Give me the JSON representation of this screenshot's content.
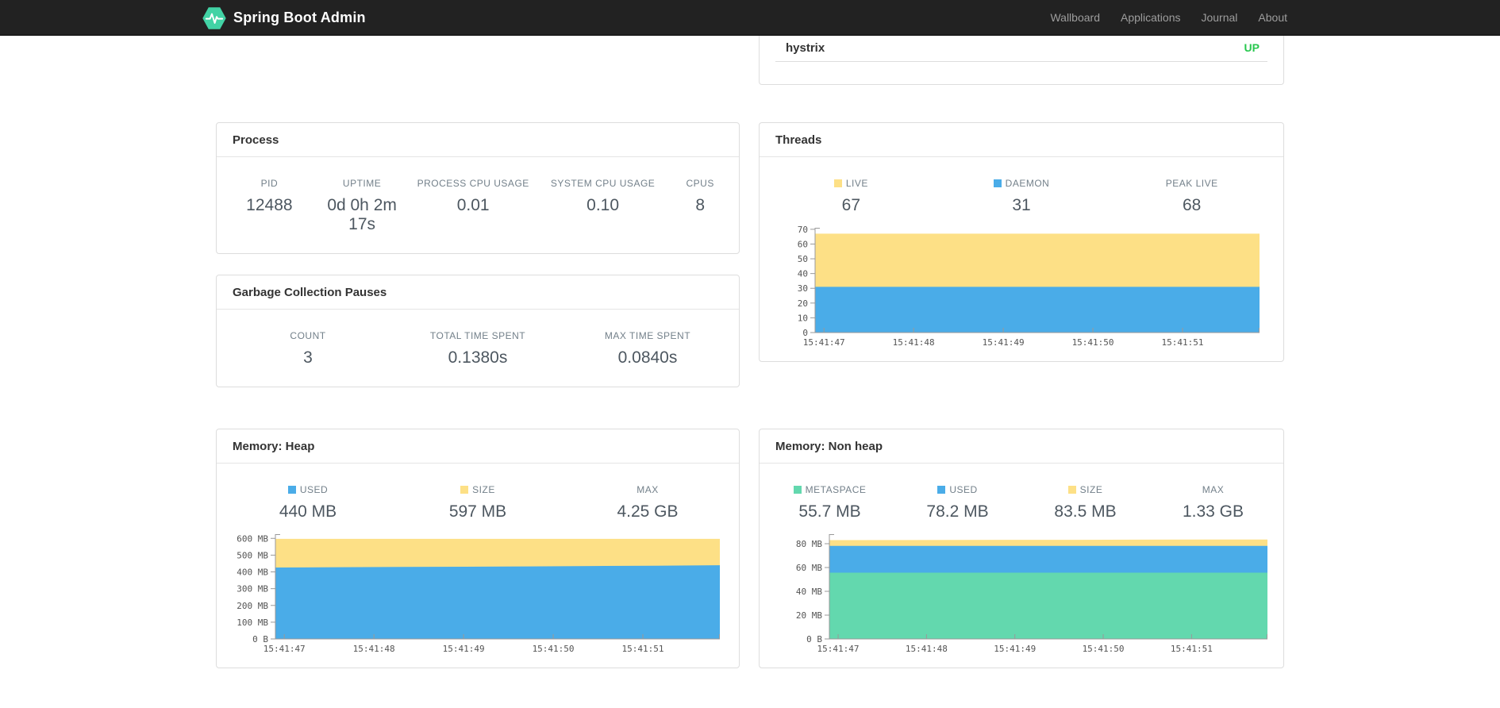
{
  "navbar": {
    "brand": "Spring Boot Admin",
    "logo_icon": "pulse-hexagon-icon",
    "brand_color": "#42d3a5",
    "links": [
      {
        "label": "Wallboard"
      },
      {
        "label": "Applications"
      },
      {
        "label": "Journal"
      },
      {
        "label": "About"
      }
    ]
  },
  "status_card": {
    "service": "hystrix",
    "status": "UP",
    "status_color": "#28c84f"
  },
  "cards": {
    "process": {
      "title": "Process",
      "metrics": [
        {
          "label": "PID",
          "value": "12488"
        },
        {
          "label": "UPTIME",
          "value": "0d 0h 2m 17s"
        },
        {
          "label": "PROCESS CPU USAGE",
          "value": "0.01"
        },
        {
          "label": "SYSTEM CPU USAGE",
          "value": "0.10"
        },
        {
          "label": "CPUS",
          "value": "8"
        }
      ]
    },
    "gc": {
      "title": "Garbage Collection Pauses",
      "metrics": [
        {
          "label": "COUNT",
          "value": "3"
        },
        {
          "label": "TOTAL TIME SPENT",
          "value": "0.1380s"
        },
        {
          "label": "MAX TIME SPENT",
          "value": "0.0840s"
        }
      ]
    },
    "threads": {
      "title": "Threads",
      "metrics": [
        {
          "label": "LIVE",
          "value": "67",
          "swatch": "#FDE086"
        },
        {
          "label": "DAEMON",
          "value": "31",
          "swatch": "#4AACE8"
        },
        {
          "label": "PEAK LIVE",
          "value": "68"
        }
      ]
    },
    "heap": {
      "title": "Memory: Heap",
      "metrics": [
        {
          "label": "USED",
          "value": "440 MB",
          "swatch": "#4AACE8"
        },
        {
          "label": "SIZE",
          "value": "597 MB",
          "swatch": "#FDE086"
        },
        {
          "label": "MAX",
          "value": "4.25 GB"
        }
      ]
    },
    "nonheap": {
      "title": "Memory: Non heap",
      "metrics": [
        {
          "label": "METASPACE",
          "value": "55.7 MB",
          "swatch": "#63D8AE"
        },
        {
          "label": "USED",
          "value": "78.2 MB",
          "swatch": "#4AACE8"
        },
        {
          "label": "SIZE",
          "value": "83.5 MB",
          "swatch": "#FDE086"
        },
        {
          "label": "MAX",
          "value": "1.33 GB"
        }
      ]
    }
  },
  "chart_data": [
    {
      "id": "threads",
      "type": "area",
      "title": "Threads",
      "x_labels": [
        "15:41:47",
        "15:41:48",
        "15:41:49",
        "15:41:50",
        "15:41:51"
      ],
      "ylim": [
        0,
        71
      ],
      "grid": false,
      "legend_position": "top",
      "y_ticks": [
        {
          "v": 0,
          "label": "0"
        },
        {
          "v": 10,
          "label": "10"
        },
        {
          "v": 20,
          "label": "20"
        },
        {
          "v": 30,
          "label": "30"
        },
        {
          "v": 40,
          "label": "40"
        },
        {
          "v": 50,
          "label": "50"
        },
        {
          "v": 60,
          "label": "60"
        },
        {
          "v": 70,
          "label": "70"
        }
      ],
      "stacking": "values are cumulative stack tops",
      "series": [
        {
          "name": "DAEMON",
          "color": "#4AACE8",
          "values": [
            31,
            31,
            31,
            31,
            31,
            31,
            31,
            31
          ]
        },
        {
          "name": "LIVE",
          "color": "#FDE086",
          "values": [
            67,
            67,
            67,
            67,
            67,
            67,
            67,
            67
          ]
        }
      ]
    },
    {
      "id": "memory-heap",
      "type": "area",
      "title": "Memory: Heap",
      "x_labels": [
        "15:41:47",
        "15:41:48",
        "15:41:49",
        "15:41:50",
        "15:41:51"
      ],
      "ylim": [
        0,
        625
      ],
      "grid": false,
      "legend_position": "top",
      "y_ticks": [
        {
          "v": 0,
          "label": "0 B"
        },
        {
          "v": 100,
          "label": "100 MB"
        },
        {
          "v": 200,
          "label": "200 MB"
        },
        {
          "v": 300,
          "label": "300 MB"
        },
        {
          "v": 400,
          "label": "400 MB"
        },
        {
          "v": 500,
          "label": "500 MB"
        },
        {
          "v": 600,
          "label": "600 MB"
        }
      ],
      "stacking": "values are cumulative stack tops (MB)",
      "series": [
        {
          "name": "USED",
          "color": "#4AACE8",
          "values": [
            426,
            428,
            430,
            431,
            433,
            435,
            437,
            440
          ]
        },
        {
          "name": "SIZE",
          "color": "#FDE086",
          "values": [
            597,
            597,
            597,
            597,
            597,
            597,
            597,
            597
          ]
        }
      ]
    },
    {
      "id": "memory-nonheap",
      "type": "area",
      "title": "Memory: Non heap",
      "x_labels": [
        "15:41:47",
        "15:41:48",
        "15:41:49",
        "15:41:50",
        "15:41:51"
      ],
      "ylim": [
        0,
        88
      ],
      "grid": false,
      "legend_position": "top",
      "y_ticks": [
        {
          "v": 0,
          "label": "0 B"
        },
        {
          "v": 20,
          "label": "20 MB"
        },
        {
          "v": 40,
          "label": "40 MB"
        },
        {
          "v": 60,
          "label": "60 MB"
        },
        {
          "v": 80,
          "label": "80 MB"
        }
      ],
      "stacking": "values are cumulative stack tops (MB)",
      "series": [
        {
          "name": "METASPACE",
          "color": "#63D8AE",
          "values": [
            55.7,
            55.7,
            55.7,
            55.7,
            55.7,
            55.7,
            55.7,
            55.7
          ]
        },
        {
          "name": "USED",
          "color": "#4AACE8",
          "values": [
            78.2,
            78.2,
            78.2,
            78.2,
            78.2,
            78.2,
            78.2,
            78.2
          ]
        },
        {
          "name": "SIZE",
          "color": "#FDE086",
          "values": [
            83.0,
            83.1,
            83.2,
            83.3,
            83.3,
            83.4,
            83.5,
            83.5
          ]
        }
      ]
    }
  ]
}
